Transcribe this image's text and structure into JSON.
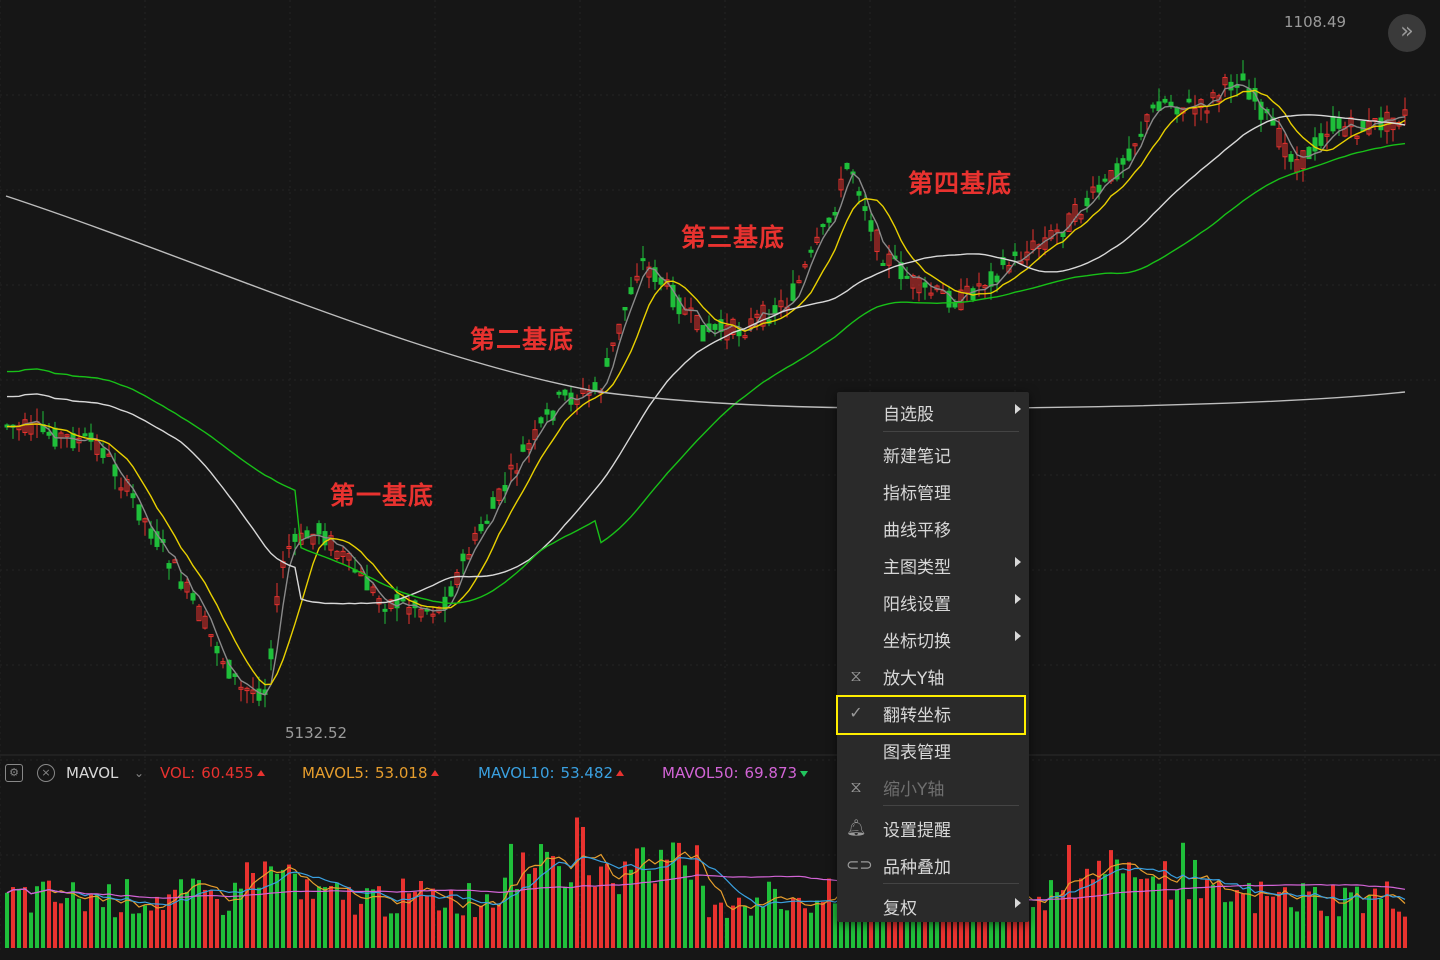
{
  "chart": {
    "high_label": "1108.49",
    "low_label": "5132.52",
    "base_labels": [
      "第一基底",
      "第二基底",
      "第三基底",
      "第四基底"
    ],
    "nav_button": "»",
    "colors": {
      "up": "#e8322f",
      "down": "#1fbf3a",
      "ma_white": "#d8d8d8",
      "ma_yellow": "#e8d000",
      "ma_green": "#18c018",
      "ma_gray": "#8a8a8a",
      "mavol50": "#d264d6",
      "mavol5": "#e69d2d",
      "mavol10": "#3aa0e0"
    }
  },
  "indicator": {
    "settings_icon": "gear-icon",
    "close_icon": "close-icon",
    "name": "MAVOL",
    "vol_label": "VOL:",
    "vol_value": "60.455",
    "mavol5_label": "MAVOL5:",
    "mavol5_value": "53.018",
    "mavol10_label": "MAVOL10:",
    "mavol10_value": "53.482",
    "mavol50_label": "MAVOL50:",
    "mavol50_value": "69.873"
  },
  "menu": {
    "items": [
      {
        "label": "自选股",
        "submenu": true
      },
      {
        "label": "新建笔记"
      },
      {
        "label": "指标管理"
      },
      {
        "label": "曲线平移"
      },
      {
        "label": "主图类型",
        "submenu": true
      },
      {
        "label": "阳线设置",
        "submenu": true
      },
      {
        "label": "坐标切换",
        "submenu": true
      },
      {
        "label": "放大Y轴",
        "icon": "zoom-in-y-icon"
      },
      {
        "label": "翻转坐标",
        "icon": "check-icon",
        "checked": true
      },
      {
        "label": "图表管理"
      },
      {
        "label": "缩小Y轴",
        "icon": "zoom-out-y-icon",
        "disabled": true
      },
      {
        "label": "设置提醒",
        "icon": "bell-icon"
      },
      {
        "label": "品种叠加",
        "icon": "overlay-icon"
      },
      {
        "label": "复权",
        "submenu": true
      }
    ]
  }
}
